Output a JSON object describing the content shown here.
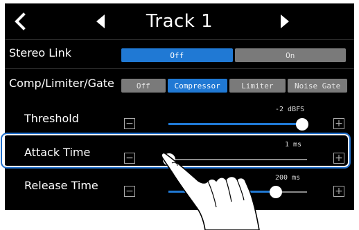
{
  "header": {
    "title": "Track 1",
    "back_icon": "chevron-left-icon",
    "prev_icon": "triangle-left-icon",
    "next_icon": "triangle-right-icon"
  },
  "stereo_link": {
    "label": "Stereo Link",
    "options": [
      "Off",
      "On"
    ],
    "selected": "Off"
  },
  "comp": {
    "label": "Comp/Limiter/Gate",
    "options": [
      "Off",
      "Compressor",
      "Limiter",
      "Noise Gate"
    ],
    "selected": "Compressor"
  },
  "threshold": {
    "label": "Threshold",
    "value": "-2 dBFS",
    "minus": "−",
    "plus": "+"
  },
  "attack": {
    "label": "Attack Time",
    "value": "1 ms",
    "minus": "−",
    "plus": "+"
  },
  "release": {
    "label": "Release Time",
    "value": "200 ms",
    "minus": "−",
    "plus": "+"
  },
  "colors": {
    "accent": "#2079d4",
    "highlight": "#1f6fcc",
    "background": "#000000"
  }
}
